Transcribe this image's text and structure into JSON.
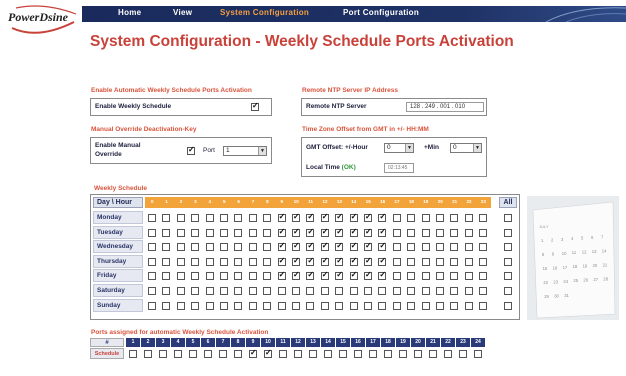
{
  "logo": {
    "text": "PowerDsine"
  },
  "nav": {
    "items": [
      {
        "label": "Home",
        "active": false
      },
      {
        "label": "View",
        "active": false
      },
      {
        "label": "System Configuration",
        "active": true
      },
      {
        "label": "Port Configuration",
        "active": false
      }
    ]
  },
  "page": {
    "title": "System Configuration - Weekly Schedule Ports Activation"
  },
  "enable_section": {
    "heading": "Enable Automatic Weekly Schedule Ports Activation",
    "label": "Enable Weekly Schedule",
    "checked": true
  },
  "ntp_section": {
    "heading": "Remote NTP Server IP Address",
    "label": "Remote NTP Server",
    "value": "128 . 249 . 001 . 010"
  },
  "override_section": {
    "heading": "Manual Override Deactivation-Key",
    "label_line1": "Enable Manual",
    "label_line2": "Override",
    "checked": true,
    "port_label": "Port",
    "port_value": "1"
  },
  "timezone_section": {
    "heading": "Time Zone Offset from GMT in +/- HH:MM",
    "offset_label": "GMT Offset: +/-Hour",
    "hour_value": "0",
    "min_label": "+Min",
    "min_value": "0",
    "local_time_label": "Local Time",
    "local_time_status": "(OK)",
    "local_time_value": "02:13:45"
  },
  "schedule": {
    "heading": "Weekly Schedule",
    "corner_label": "Day \\ Hour",
    "all_label": "All",
    "hours": [
      "0",
      "1",
      "2",
      "3",
      "4",
      "5",
      "6",
      "7",
      "8",
      "9",
      "10",
      "11",
      "12",
      "13",
      "14",
      "15",
      "16",
      "17",
      "18",
      "19",
      "20",
      "21",
      "22",
      "23"
    ],
    "days": [
      {
        "name": "Monday",
        "checked": [
          9,
          10,
          11,
          12,
          13,
          14,
          15,
          16
        ]
      },
      {
        "name": "Tuesday",
        "checked": [
          9,
          10,
          11,
          12,
          13,
          14,
          15,
          16
        ]
      },
      {
        "name": "Wednesday",
        "checked": [
          9,
          10,
          11,
          12,
          13,
          14,
          15,
          16
        ]
      },
      {
        "name": "Thursday",
        "checked": [
          9,
          10,
          11,
          12,
          13,
          14,
          15,
          16
        ]
      },
      {
        "name": "Friday",
        "checked": [
          9,
          10,
          11,
          12,
          13,
          14,
          15,
          16
        ]
      },
      {
        "name": "Saturday",
        "checked": []
      },
      {
        "name": "Sunday",
        "checked": []
      }
    ]
  },
  "ports_section": {
    "heading": "Ports assigned for automatic Weekly Schedule Activation",
    "hash_label": "#",
    "schedule_label": "Schedule",
    "ports": [
      "1",
      "2",
      "3",
      "4",
      "5",
      "6",
      "7",
      "8",
      "9",
      "10",
      "11",
      "12",
      "13",
      "14",
      "15",
      "16",
      "17",
      "18",
      "19",
      "20",
      "21",
      "22",
      "23",
      "24"
    ],
    "checked": [
      9,
      10
    ]
  },
  "calendar": {
    "month_label": "JULY",
    "dates": [
      "1",
      "2",
      "3",
      "4",
      "5",
      "6",
      "7",
      "8",
      "9",
      "10",
      "11",
      "12",
      "13",
      "14",
      "15",
      "16",
      "17",
      "18",
      "19",
      "20",
      "21",
      "22",
      "23",
      "24",
      "25",
      "26",
      "27",
      "28",
      "29",
      "30",
      "31"
    ]
  },
  "colors": {
    "accent": "#c8423a",
    "header_orange": "#f2a43a",
    "nav_bg": "#1a2a5c",
    "port_header": "#2a3a78"
  }
}
